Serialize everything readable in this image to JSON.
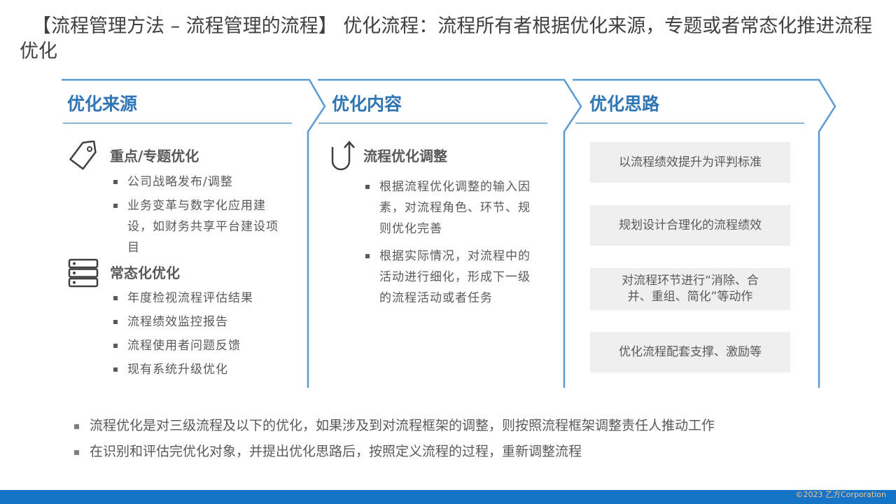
{
  "title": "【流程管理方法 – 流程管理的流程】  优化流程：流程所有者根据优化来源，专题或者常态化推进流程优化",
  "columns": {
    "sources": {
      "heading": "优化来源",
      "groups": [
        {
          "title": "重点/专题优化",
          "icon": "tag-icon",
          "items": [
            "公司战略发布/调整",
            "业务变革与数字化应用建设，如财务共享平台建设项目"
          ]
        },
        {
          "title": "常态化优化",
          "icon": "server-stack-icon",
          "items": [
            "年度检视流程评估结果",
            "流程绩效监控报告",
            "流程使用者问题反馈",
            "现有系统升级优化"
          ]
        }
      ]
    },
    "content": {
      "heading": "优化内容",
      "title": "流程优化调整",
      "icon": "u-turn-arrow-icon",
      "items": [
        "根据流程优化调整的输入因素，对流程角色、环节、规则优化完善",
        "根据实际情况，对流程中的活动进行细化，形成下一级的流程活动或者任务"
      ]
    },
    "approach": {
      "heading": "优化思路",
      "boxes": [
        "以流程绩效提升为评判标准",
        "规划设计合理化的流程绩效",
        "对流程环节进行“消除、合并、重组、简化”等动作",
        "优化流程配套支撑、激励等"
      ]
    }
  },
  "notes": [
    "流程优化是对三级流程及以下的优化，如果涉及到对流程框架的调整，则按照流程框架调整责任人推动工作",
    "在识别和评估完优化对象，并提出优化思路后，按照定义流程的过程，重新调整流程"
  ],
  "footer": {
    "copyright": "©2023 乙方Corporation"
  },
  "colors": {
    "accent": "#2e75b6",
    "frame": "#5b9bd5",
    "bar": "#1773c5",
    "box": "#efefef"
  }
}
